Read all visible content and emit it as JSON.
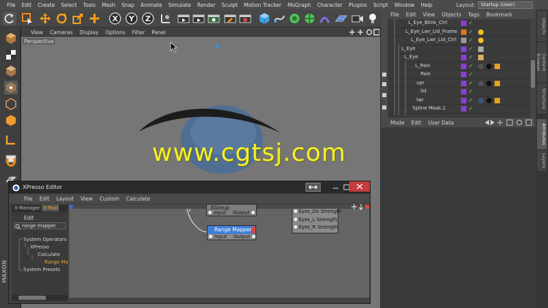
{
  "menubar": {
    "items": [
      "File",
      "Edit",
      "Create",
      "Select",
      "Tools",
      "Mesh",
      "Snap",
      "Animate",
      "Simulate",
      "Render",
      "Sculpt",
      "Motion Tracker",
      "MoGraph",
      "Character",
      "Plugins",
      "Script",
      "Window",
      "Help"
    ],
    "layout_label": "Layout:",
    "layout_value": "Startup (User)"
  },
  "toolbar": {
    "axis_x": "X",
    "axis_y": "Y",
    "axis_z": "Z"
  },
  "viewport": {
    "menu": [
      "View",
      "Cameras",
      "Display",
      "Options",
      "Filter",
      "Panel"
    ],
    "camera_label": "Perspective"
  },
  "objects": {
    "menu": [
      "File",
      "Edit",
      "View",
      "Objects",
      "Tags",
      "Bookmark"
    ],
    "rows": [
      {
        "name": "L_Eye_Blink_Ctrl"
      },
      {
        "name": "L_Eye_Lwr_Lid_Frame"
      },
      {
        "name": "L_Eye_Lwr_Lid_Ctrl"
      },
      {
        "name": "L_Eye"
      },
      {
        "name": "L_Eye"
      },
      {
        "name": "L_Pain"
      },
      {
        "name": "Pain"
      },
      {
        "name": "upr"
      },
      {
        "name": "lid"
      },
      {
        "name": "lwr"
      },
      {
        "name": "Spline Mask.1"
      }
    ]
  },
  "attributes": {
    "menu": [
      "Mode",
      "Edit",
      "User Data"
    ]
  },
  "sidetabs": [
    "Objects",
    "Content Browser",
    "Structure",
    "Attributes",
    "Layers"
  ],
  "xpresso": {
    "title": "XPresso Editor",
    "menu": [
      "File",
      "Edit",
      "Layout",
      "View",
      "Custom",
      "Calculate"
    ],
    "tabs": [
      "X-Manager",
      "X-Pool"
    ],
    "side_edit": "Edit",
    "search_value": "range mapper",
    "tree": [
      "System Operators",
      "XPresso",
      "Calculate",
      "Range Mapper",
      "System Presets"
    ],
    "nodes": {
      "xgroup": {
        "title": "XGroup",
        "input": "Input",
        "output": "Output"
      },
      "range_mapper": {
        "title": "Range Mapper",
        "input": "Input",
        "output": "Output"
      },
      "eyes": {
        "ports": [
          "Eyes_Dn Strength",
          "Eyes_L Strength",
          "Eyes_R Strength"
        ]
      }
    }
  },
  "watermark": "www.cgtsj.com",
  "left_brand": "MAXON"
}
